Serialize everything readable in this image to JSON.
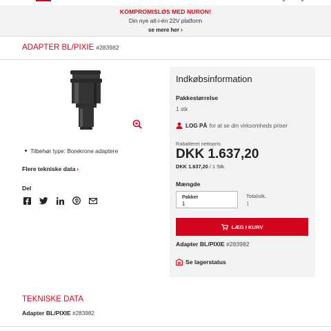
{
  "promo": {
    "headline": "KOMPROMISLØS MED NURON!",
    "subline": "Din nye alt-i-én 22V platform",
    "link": "se mere her"
  },
  "product": {
    "title": "ADAPTER BL/PIXIE",
    "sku": "#283982",
    "bullet": "Tilbehør type: Borekrone adaptere",
    "tech_link": "Flere tekniske data",
    "share_label": "Del",
    "share_icons": [
      "facebook-icon",
      "twitter-icon",
      "linkedin-icon",
      "pinterest-icon",
      "mail-icon"
    ]
  },
  "purchase": {
    "heading": "Indkøbsinformation",
    "pack_label": "Pakkestørrelse",
    "pack_value": "1 stk",
    "login_strong": "LOG PÅ",
    "login_text": "for at se din virksomheds priser",
    "net_label": "Rabatteret nettopris",
    "price": "DKK 1.637,20",
    "unit_price": "DKK 1.637,20",
    "unit_suffix": "/ 1 Stk.",
    "qty_label": "Mængde",
    "packs_label": "Pakker",
    "packs_value": "1",
    "total_label": "Totalstk.",
    "total_value": "1",
    "cart_button": "LÆG I KURV",
    "ref_name": "Adapter BL/PIXIE",
    "ref_sku": "#283982",
    "stock_link": "Se lagerstatus"
  },
  "tech": {
    "heading": "TEKNISKE DATA",
    "ref_name": "Adapter BL/PIXIE",
    "ref_sku": "#283982"
  },
  "colors": {
    "accent": "#d2051e",
    "panel_bg": "#f3f3f3"
  }
}
